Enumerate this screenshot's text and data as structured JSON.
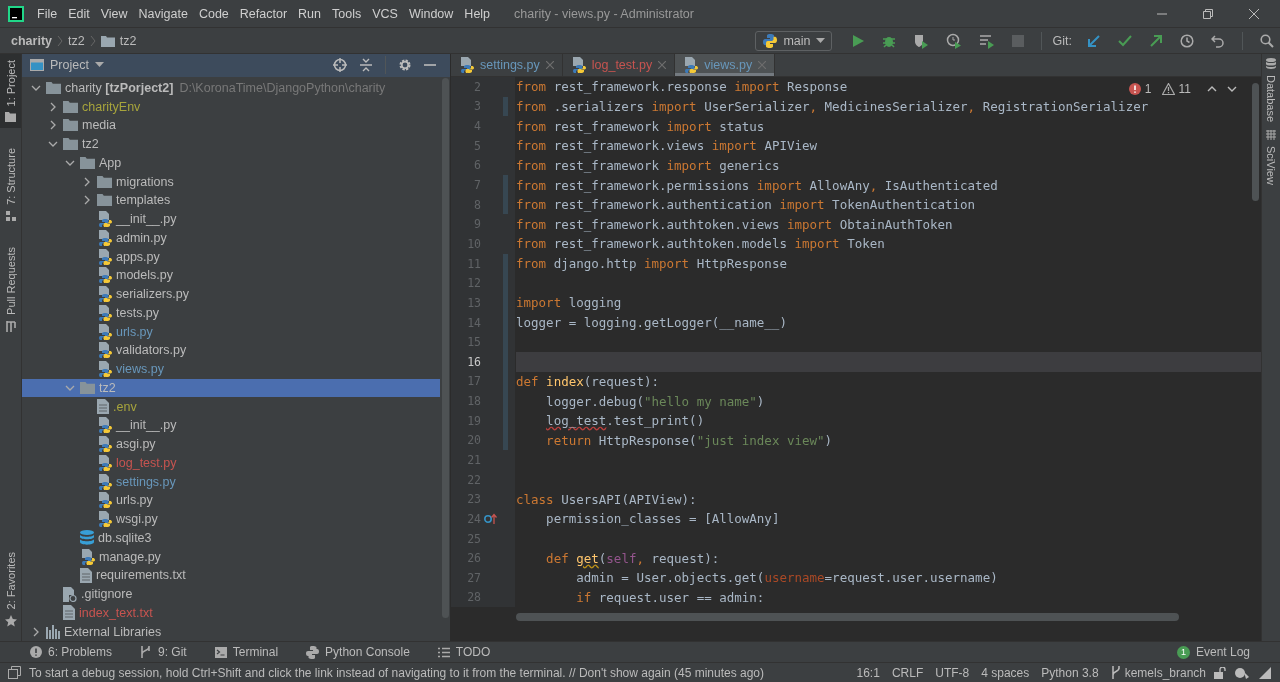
{
  "window": {
    "title": "charity - views.py - Administrator"
  },
  "menu": [
    "File",
    "Edit",
    "View",
    "Navigate",
    "Code",
    "Refactor",
    "Run",
    "Tools",
    "VCS",
    "Window",
    "Help"
  ],
  "breadcrumbs": [
    "charity",
    "tz2",
    "tz2"
  ],
  "run_config": "main",
  "git_label": "Git:",
  "left_stripe": [
    {
      "label": "1: Project",
      "selected": true,
      "kind": "project"
    },
    {
      "label": "7: Structure",
      "selected": false,
      "kind": "structure"
    },
    {
      "label": "Pull Requests",
      "selected": false,
      "kind": "pull"
    },
    {
      "label": "2: Favorites",
      "selected": false,
      "kind": "favorites"
    }
  ],
  "right_stripe": [
    {
      "label": "Database",
      "kind": "database"
    },
    {
      "label": "SciView",
      "kind": "sciview"
    }
  ],
  "project_panel": {
    "title": "Project"
  },
  "tree": [
    {
      "label": "charity **[tzPorject2]**",
      "path": "D:\\KoronaTime\\DjangoPython\\charity",
      "kind": "folder",
      "color": "#bbbbbb",
      "expanded": true,
      "selected": false,
      "children": [
        {
          "label": "charityEnv",
          "kind": "folder",
          "color": "#a7a43c",
          "expanded": false,
          "selected": false
        },
        {
          "label": "media",
          "kind": "folder",
          "color": "#bbbbbb",
          "expanded": false,
          "selected": false
        },
        {
          "label": "tz2",
          "kind": "folder",
          "color": "#bbbbbb",
          "expanded": true,
          "selected": false,
          "children": [
            {
              "label": "App",
              "kind": "folder",
              "color": "#bbbbbb",
              "expanded": true,
              "selected": false,
              "children": [
                {
                  "label": "migrations",
                  "kind": "folder",
                  "color": "#bbbbbb",
                  "expanded": false,
                  "selected": false
                },
                {
                  "label": "templates",
                  "kind": "folder",
                  "color": "#bbbbbb",
                  "expanded": false,
                  "selected": false
                },
                {
                  "label": "__init__.py",
                  "kind": "python",
                  "color": "#bbbbbb",
                  "selected": false
                },
                {
                  "label": "admin.py",
                  "kind": "python",
                  "color": "#bbbbbb",
                  "selected": false
                },
                {
                  "label": "apps.py",
                  "kind": "python",
                  "color": "#bbbbbb",
                  "selected": false
                },
                {
                  "label": "models.py",
                  "kind": "python",
                  "color": "#bbbbbb",
                  "selected": false
                },
                {
                  "label": "serializers.py",
                  "kind": "python",
                  "color": "#bbbbbb",
                  "selected": false
                },
                {
                  "label": "tests.py",
                  "kind": "python",
                  "color": "#bbbbbb",
                  "selected": false
                },
                {
                  "label": "urls.py",
                  "kind": "python",
                  "color": "#6897bb",
                  "selected": false
                },
                {
                  "label": "validators.py",
                  "kind": "python",
                  "color": "#bbbbbb",
                  "selected": false
                },
                {
                  "label": "views.py",
                  "kind": "python",
                  "color": "#6897bb",
                  "selected": false
                }
              ]
            },
            {
              "label": "tz2",
              "kind": "folder",
              "color": "#bbbbbb",
              "expanded": true,
              "selected": true,
              "children": [
                {
                  "label": ".env",
                  "kind": "text",
                  "color": "#a7a43c",
                  "selected": false
                },
                {
                  "label": "__init__.py",
                  "kind": "python",
                  "color": "#bbbbbb",
                  "selected": false
                },
                {
                  "label": "asgi.py",
                  "kind": "python",
                  "color": "#bbbbbb",
                  "selected": false
                },
                {
                  "label": "log_test.py",
                  "kind": "python",
                  "color": "#c75450",
                  "selected": false
                },
                {
                  "label": "settings.py",
                  "kind": "python",
                  "color": "#6897bb",
                  "selected": false
                },
                {
                  "label": "urls.py",
                  "kind": "python",
                  "color": "#bbbbbb",
                  "selected": false
                },
                {
                  "label": "wsgi.py",
                  "kind": "python",
                  "color": "#bbbbbb",
                  "selected": false
                }
              ]
            },
            {
              "label": "db.sqlite3",
              "kind": "database",
              "color": "#bbbbbb",
              "selected": false
            },
            {
              "label": "manage.py",
              "kind": "python",
              "color": "#bbbbbb",
              "selected": false
            },
            {
              "label": "requirements.txt",
              "kind": "text",
              "color": "#bbbbbb",
              "selected": false
            }
          ]
        },
        {
          "label": ".gitignore",
          "kind": "ignore",
          "color": "#bbbbbb",
          "selected": false
        },
        {
          "label": "index_text.txt",
          "kind": "text",
          "color": "#c75450",
          "selected": false
        }
      ]
    },
    {
      "label": "External Libraries",
      "kind": "library",
      "color": "#bbbbbb",
      "expanded": false,
      "selected": false
    }
  ],
  "editor_tabs": [
    {
      "label": "settings.py",
      "color": "#6897bb",
      "selected": false
    },
    {
      "label": "log_test.py",
      "color": "#c75450",
      "selected": false
    },
    {
      "label": "views.py",
      "color": "#6897bb",
      "selected": true
    }
  ],
  "inspections": {
    "errors": "1",
    "warnings": "11"
  },
  "code": [
    {
      "num": "2",
      "current": false,
      "changed": false,
      "tokens": [
        {
          "text": "from",
          "kind": "keyword"
        },
        {
          "text": " rest_framework.response ",
          "kind": "plain"
        },
        {
          "text": "import",
          "kind": "keyword"
        },
        {
          "text": " Response",
          "kind": "plain"
        }
      ]
    },
    {
      "num": "3",
      "current": false,
      "changed": true,
      "tokens": [
        {
          "text": "from",
          "kind": "keyword"
        },
        {
          "text": " .serializers ",
          "kind": "plain"
        },
        {
          "text": "import",
          "kind": "keyword"
        },
        {
          "text": " UserSerializer",
          "kind": "plain"
        },
        {
          "text": ",",
          "kind": "keyword"
        },
        {
          "text": " MedicinesSerializer",
          "kind": "plain"
        },
        {
          "text": ",",
          "kind": "keyword"
        },
        {
          "text": " RegistrationSerializer",
          "kind": "plain"
        }
      ]
    },
    {
      "num": "4",
      "current": false,
      "changed": false,
      "tokens": [
        {
          "text": "from",
          "kind": "keyword"
        },
        {
          "text": " rest_framework ",
          "kind": "plain"
        },
        {
          "text": "import",
          "kind": "keyword"
        },
        {
          "text": " status",
          "kind": "plain"
        }
      ]
    },
    {
      "num": "5",
      "current": false,
      "changed": false,
      "tokens": [
        {
          "text": "from",
          "kind": "keyword"
        },
        {
          "text": " rest_framework.views ",
          "kind": "plain"
        },
        {
          "text": "import",
          "kind": "keyword"
        },
        {
          "text": " APIView",
          "kind": "plain"
        }
      ]
    },
    {
      "num": "6",
      "current": false,
      "changed": false,
      "tokens": [
        {
          "text": "from",
          "kind": "keyword"
        },
        {
          "text": " rest_framework ",
          "kind": "plain"
        },
        {
          "text": "import",
          "kind": "keyword"
        },
        {
          "text": " generics",
          "kind": "plain"
        }
      ]
    },
    {
      "num": "7",
      "current": false,
      "changed": true,
      "tokens": [
        {
          "text": "from",
          "kind": "keyword"
        },
        {
          "text": " rest_framework.permissions ",
          "kind": "plain"
        },
        {
          "text": "import",
          "kind": "keyword"
        },
        {
          "text": " AllowAny",
          "kind": "plain"
        },
        {
          "text": ",",
          "kind": "keyword"
        },
        {
          "text": " IsAuthenticated",
          "kind": "plain"
        }
      ]
    },
    {
      "num": "8",
      "current": false,
      "changed": true,
      "tokens": [
        {
          "text": "from",
          "kind": "keyword"
        },
        {
          "text": " rest_framework.authentication ",
          "kind": "plain"
        },
        {
          "text": "import",
          "kind": "keyword"
        },
        {
          "text": " TokenAuthentication",
          "kind": "plain"
        }
      ]
    },
    {
      "num": "9",
      "current": false,
      "changed": false,
      "tokens": [
        {
          "text": "from",
          "kind": "keyword"
        },
        {
          "text": " rest_framework.authtoken.views ",
          "kind": "plain"
        },
        {
          "text": "import",
          "kind": "keyword"
        },
        {
          "text": " ObtainAuthToken",
          "kind": "plain"
        }
      ]
    },
    {
      "num": "10",
      "current": false,
      "changed": false,
      "tokens": [
        {
          "text": "from",
          "kind": "keyword"
        },
        {
          "text": " rest_framework.authtoken.models ",
          "kind": "plain"
        },
        {
          "text": "import",
          "kind": "keyword"
        },
        {
          "text": " Token",
          "kind": "plain"
        }
      ]
    },
    {
      "num": "11",
      "current": false,
      "changed": true,
      "tokens": [
        {
          "text": "from",
          "kind": "keyword"
        },
        {
          "text": " django.http ",
          "kind": "plain"
        },
        {
          "text": "import",
          "kind": "keyword"
        },
        {
          "text": " HttpResponse",
          "kind": "plain"
        }
      ]
    },
    {
      "num": "12",
      "current": false,
      "changed": true
    },
    {
      "num": "13",
      "current": false,
      "changed": true,
      "tokens": [
        {
          "text": "import",
          "kind": "keyword"
        },
        {
          "text": " logging",
          "kind": "plain"
        }
      ]
    },
    {
      "num": "14",
      "current": false,
      "changed": true,
      "tokens": [
        {
          "text": "logger = logging.getLogger(__name__)",
          "kind": "plain"
        }
      ]
    },
    {
      "num": "15",
      "current": false,
      "changed": true
    },
    {
      "num": "16",
      "current": true,
      "changed": true
    },
    {
      "num": "17",
      "current": false,
      "changed": true,
      "tokens": [
        {
          "text": "def ",
          "kind": "keyword"
        },
        {
          "text": "index",
          "kind": "function"
        },
        {
          "text": "(request):",
          "kind": "plain"
        }
      ]
    },
    {
      "num": "18",
      "current": false,
      "changed": true,
      "tokens": [
        {
          "text": "    logger.debug(",
          "kind": "plain"
        },
        {
          "text": "\"hello my name\"",
          "kind": "string"
        },
        {
          "text": ")",
          "kind": "plain"
        }
      ]
    },
    {
      "num": "19",
      "current": false,
      "changed": true,
      "tokens": [
        {
          "text": "    log_test",
          "kind": "error"
        },
        {
          "text": ".test_print()",
          "kind": "plain"
        }
      ]
    },
    {
      "num": "20",
      "current": false,
      "changed": true,
      "tokens": [
        {
          "text": "    return",
          "kind": "keyword"
        },
        {
          "text": " HttpResponse(",
          "kind": "plain"
        },
        {
          "text": "\"just index view\"",
          "kind": "string"
        },
        {
          "text": ")",
          "kind": "plain"
        }
      ]
    },
    {
      "num": "21",
      "current": false,
      "changed": false
    },
    {
      "num": "22",
      "current": false,
      "changed": false
    },
    {
      "num": "23",
      "current": false,
      "changed": false,
      "tokens": [
        {
          "text": "class",
          "kind": "keyword"
        },
        {
          "text": " UsersAPI(APIView):",
          "kind": "plain"
        }
      ]
    },
    {
      "num": "24",
      "current": false,
      "changed": false,
      "override": true,
      "tokens": [
        {
          "text": "    permission_classes = [AllowAny]",
          "kind": "plain"
        }
      ]
    },
    {
      "num": "25",
      "current": false,
      "changed": false
    },
    {
      "num": "26",
      "current": false,
      "changed": false,
      "tokens": [
        {
          "text": "    def ",
          "kind": "keyword"
        },
        {
          "text": "get",
          "kind": "warning"
        },
        {
          "text": "(",
          "kind": "plain"
        },
        {
          "text": "self",
          "kind": "self"
        },
        {
          "text": ",",
          "kind": "keyword"
        },
        {
          "text": " request):",
          "kind": "plain"
        }
      ]
    },
    {
      "num": "27",
      "current": false,
      "changed": false,
      "tokens": [
        {
          "text": "        admin = User.objects.get(",
          "kind": "plain"
        },
        {
          "text": "username",
          "kind": "param"
        },
        {
          "text": "=request.user.username)",
          "kind": "plain"
        }
      ]
    },
    {
      "num": "28",
      "current": false,
      "changed": false,
      "tokens": [
        {
          "text": "        if",
          "kind": "keyword"
        },
        {
          "text": " request.user == admin:",
          "kind": "plain"
        }
      ]
    }
  ],
  "tool_windows": [
    {
      "label": "6: Problems",
      "kind": "problems"
    },
    {
      "label": "9: Git",
      "kind": "git"
    },
    {
      "label": "Terminal",
      "kind": "terminal"
    },
    {
      "label": "Python Console",
      "kind": "console"
    },
    {
      "label": "TODO",
      "kind": "todo"
    }
  ],
  "event_log": {
    "label": "Event Log",
    "count": "1"
  },
  "status": {
    "message": "To start a debug session, hold Ctrl+Shift and click the link instead of navigating to it from the terminal. // Don't show again (45 minutes ago)",
    "items": [
      "16:1",
      "CRLF",
      "UTF-8",
      "4 spaces",
      "Python 3.8"
    ],
    "branch": "kemels_branch"
  }
}
